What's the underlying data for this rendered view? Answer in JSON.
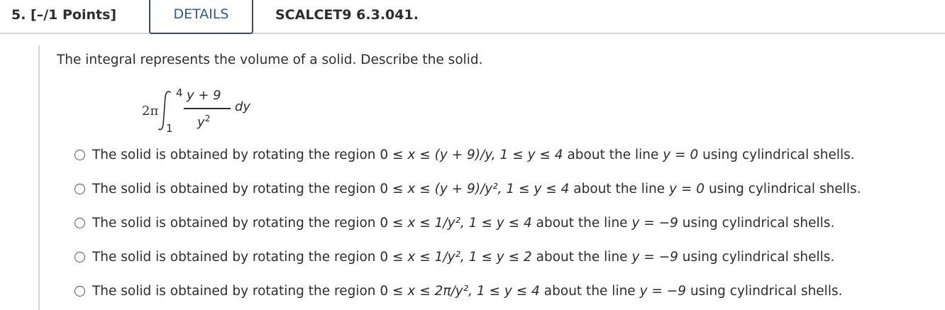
{
  "header": {
    "question_label": "5. [–/1 Points]",
    "details_tab": "DETAILS",
    "assignment_code": "SCALCET9 6.3.041."
  },
  "question": {
    "prompt": "The integral represents the volume of a solid. Describe the solid.",
    "integral": {
      "coefficient": "2π",
      "upper_limit": "4",
      "lower_limit": "1",
      "numerator": "y + 9",
      "denominator_base": "y",
      "denominator_exp": "2",
      "differential": "dy"
    }
  },
  "options": [
    {
      "pre": "The solid is obtained by rotating the region 0 ≤ ",
      "region": "x ≤ (y + 9)/y, 1 ≤ y ≤ 4",
      "about": " about the line ",
      "line": "y = 0",
      "post": " using cylindrical shells."
    },
    {
      "pre": "The solid is obtained by rotating the region 0 ≤ ",
      "region": "x ≤ (y + 9)/y², 1 ≤ y ≤ 4",
      "about": " about the line ",
      "line": "y = 0",
      "post": " using cylindrical shells."
    },
    {
      "pre": "The solid is obtained by rotating the region 0 ≤ ",
      "region": "x ≤ 1/y², 1 ≤ y ≤ 4",
      "about": " about the line ",
      "line": "y = −9",
      "post": " using cylindrical shells."
    },
    {
      "pre": "The solid is obtained by rotating the region 0 ≤ ",
      "region": "x ≤ 1/y², 1 ≤ y ≤ 2",
      "about": " about the line ",
      "line": "y = −9",
      "post": " using cylindrical shells."
    },
    {
      "pre": "The solid is obtained by rotating the region 0 ≤ ",
      "region": "x ≤ 2π/y², 1 ≤ y ≤ 4",
      "about": " about the line ",
      "line": "y = −9",
      "post": " using cylindrical shells."
    }
  ]
}
